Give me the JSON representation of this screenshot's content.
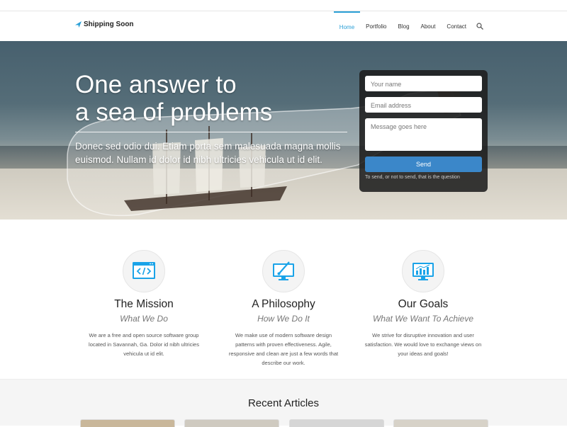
{
  "brand": {
    "name": "Shipping Soon"
  },
  "nav": {
    "items": [
      {
        "label": "Home"
      },
      {
        "label": "Portfolio"
      },
      {
        "label": "Blog"
      },
      {
        "label": "About"
      },
      {
        "label": "Contact"
      }
    ],
    "active": "Home"
  },
  "hero": {
    "title_line1": "One answer to",
    "title_line2": "a sea of problems",
    "subtitle": "Donec sed odio dui. Etiam porta sem malesuada magna mollis euismod. Nullam id dolor id nibh ultricies vehicula ut id elit."
  },
  "contact_form": {
    "name_placeholder": "Your name",
    "email_placeholder": "Email address",
    "message_placeholder": "Message goes here",
    "send_label": "Send",
    "note": "To send, or not to send, that is the question"
  },
  "features": [
    {
      "title": "The Mission",
      "subtitle": "What We Do",
      "text": "We are a free and open source software group located in Savannah, Ga. Dolor id nibh ultricies vehicula ut id elit.",
      "icon": "code-window-icon"
    },
    {
      "title": "A Philosophy",
      "subtitle": "How We Do It",
      "text": "We make use of modern software design patterns with proven effectiveness. Agile, responsive and clean are just a few words that describe our work.",
      "icon": "monitor-brush-icon"
    },
    {
      "title": "Our Goals",
      "subtitle": "What We Want To Achieve",
      "text": "We strive for disruptive innovation and user satisfaction. We would love to exchange views on your ideas and goals!",
      "icon": "bar-chart-monitor-icon"
    }
  ],
  "articles": {
    "title": "Recent Articles"
  },
  "colors": {
    "accent": "#2a9fd6",
    "send_button": "#3b87c9",
    "form_bg": "#1e1e1e"
  }
}
